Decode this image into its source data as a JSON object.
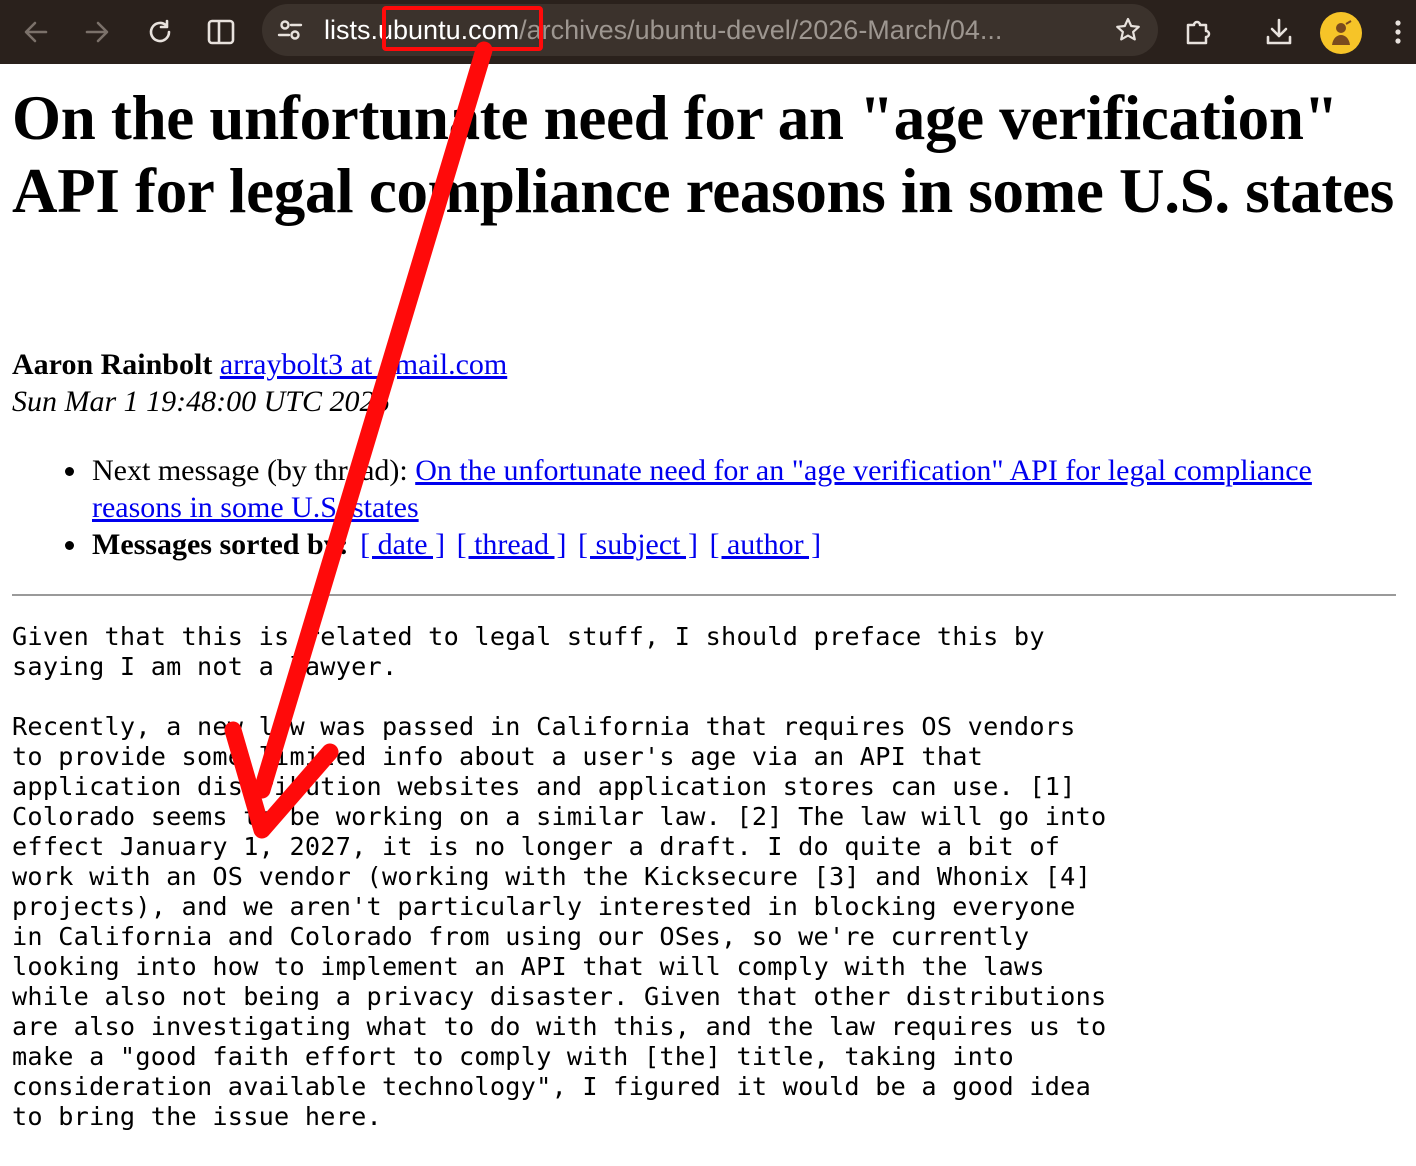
{
  "browser": {
    "url_host_prefix": "lists.",
    "url_host": "ubuntu.com",
    "url_path": "/archives/ubuntu-devel/2026-March/04...",
    "icons": {
      "back": "back-arrow-icon",
      "forward": "forward-arrow-icon",
      "reload": "reload-icon",
      "split": "split-view-icon",
      "site_info": "tune-icon",
      "bookmark": "star-icon",
      "extensions": "puzzle-icon",
      "downloads": "download-icon",
      "profile": "avatar-icon",
      "menu": "kebab-menu-icon"
    },
    "colors": {
      "toolbar": "#2a211c",
      "omnibox": "#3b322c",
      "avatar": "#f6c428"
    }
  },
  "message": {
    "title": "On the unfortunate need for an \"age verification\" API for legal compliance reasons in some U.S. states",
    "author_name": "Aaron Rainbolt",
    "author_email": "arraybolt3 at gmail.com",
    "date": "Sun Mar 1 19:48:00 UTC 2026",
    "next_message_label": "Next message (by thread):",
    "next_message_link": "On the unfortunate need for an \"age verification\" API for legal compliance reasons in some U.S. states",
    "sorted_label": "Messages sorted by:",
    "sort_links": [
      "[ date ]",
      "[ thread ]",
      "[ subject ]",
      "[ author ]"
    ],
    "body": "Given that this is related to legal stuff, I should preface this by\nsaying I am not a lawyer.\n\nRecently, a new law was passed in California that requires OS vendors\nto provide some limited info about a user's age via an API that\napplication distribution websites and application stores can use. [1]\nColorado seems to be working on a similar law. [2] The law will go into\neffect January 1, 2027, it is no longer a draft. I do quite a bit of\nwork with an OS vendor (working with the Kicksecure [3] and Whonix [4]\nprojects), and we aren't particularly interested in blocking everyone\nin California and Colorado from using our OSes, so we're currently\nlooking into how to implement an API that will comply with the laws\nwhile also not being a privacy disaster. Given that other distributions\nare also investigating what to do with this, and the law requires us to\nmake a \"good faith effort to comply with [the] title, taking into\nconsideration available technology\", I figured it would be a good idea\nto bring the issue here."
  },
  "annotation": {
    "color": "#ff0a0a",
    "highlighted_text": "ubuntu.com"
  }
}
